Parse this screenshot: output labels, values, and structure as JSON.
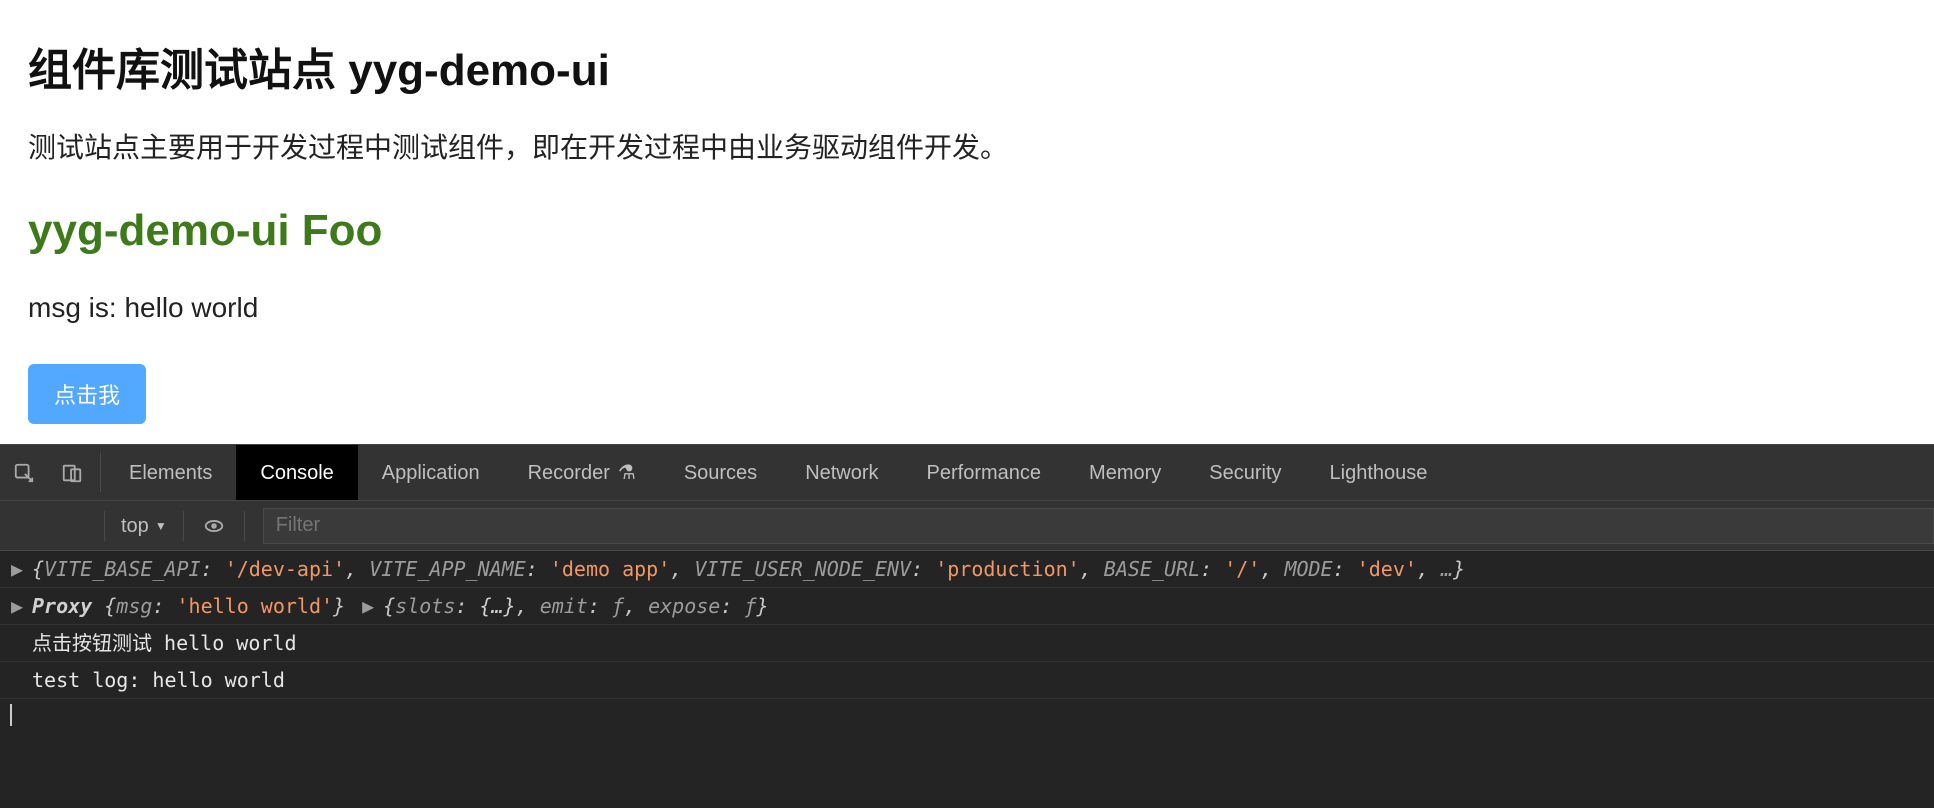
{
  "page": {
    "title": "组件库测试站点 yyg-demo-ui",
    "description": "测试站点主要用于开发过程中测试组件，即在开发过程中由业务驱动组件开发。",
    "subtitle": "yyg-demo-ui Foo",
    "msg_line": "msg is: hello world",
    "button_label": "点击我"
  },
  "devtools": {
    "tabs": [
      "Elements",
      "Console",
      "Application",
      "Recorder",
      "Sources",
      "Network",
      "Performance",
      "Memory",
      "Security",
      "Lighthouse"
    ],
    "active_tab": "Console",
    "recorder_badge": "⚗",
    "toolbar": {
      "execution_context": "top",
      "dropdown_glyph": "▼",
      "filter_placeholder": "Filter"
    },
    "console_lines": [
      {
        "expand": true,
        "tokens": [
          {
            "t": "punc",
            "v": "{"
          },
          {
            "t": "key",
            "v": "VITE_BASE_API"
          },
          {
            "t": "punc",
            "v": ": "
          },
          {
            "t": "str",
            "v": "'/dev-api'"
          },
          {
            "t": "punc",
            "v": ", "
          },
          {
            "t": "key",
            "v": "VITE_APP_NAME"
          },
          {
            "t": "punc",
            "v": ": "
          },
          {
            "t": "str",
            "v": "'demo app'"
          },
          {
            "t": "punc",
            "v": ", "
          },
          {
            "t": "key",
            "v": "VITE_USER_NODE_ENV"
          },
          {
            "t": "punc",
            "v": ": "
          },
          {
            "t": "str",
            "v": "'production'"
          },
          {
            "t": "punc",
            "v": ", "
          },
          {
            "t": "key",
            "v": "BASE_URL"
          },
          {
            "t": "punc",
            "v": ": "
          },
          {
            "t": "str",
            "v": "'/'"
          },
          {
            "t": "punc",
            "v": ", "
          },
          {
            "t": "key",
            "v": "MODE"
          },
          {
            "t": "punc",
            "v": ": "
          },
          {
            "t": "str",
            "v": "'dev'"
          },
          {
            "t": "punc",
            "v": ", "
          },
          {
            "t": "sym",
            "v": "…"
          },
          {
            "t": "punc",
            "v": "}"
          }
        ]
      },
      {
        "expand": true,
        "groups": [
          [
            {
              "t": "name",
              "v": "Proxy "
            },
            {
              "t": "punc",
              "v": "{"
            },
            {
              "t": "key",
              "v": "msg"
            },
            {
              "t": "punc",
              "v": ": "
            },
            {
              "t": "str",
              "v": "'hello world'"
            },
            {
              "t": "punc",
              "v": "}"
            }
          ],
          [
            {
              "t": "punc",
              "v": "{"
            },
            {
              "t": "key",
              "v": "slots"
            },
            {
              "t": "punc",
              "v": ": "
            },
            {
              "t": "keyb",
              "v": "{…}"
            },
            {
              "t": "punc",
              "v": ", "
            },
            {
              "t": "key",
              "v": "emit"
            },
            {
              "t": "punc",
              "v": ": "
            },
            {
              "t": "sym",
              "v": "ƒ"
            },
            {
              "t": "punc",
              "v": ", "
            },
            {
              "t": "key",
              "v": "expose"
            },
            {
              "t": "punc",
              "v": ": "
            },
            {
              "t": "sym",
              "v": "ƒ"
            },
            {
              "t": "punc",
              "v": "}"
            }
          ]
        ]
      },
      {
        "plain": "点击按钮测试 hello world"
      },
      {
        "plain": "test log:  hello world"
      }
    ]
  }
}
